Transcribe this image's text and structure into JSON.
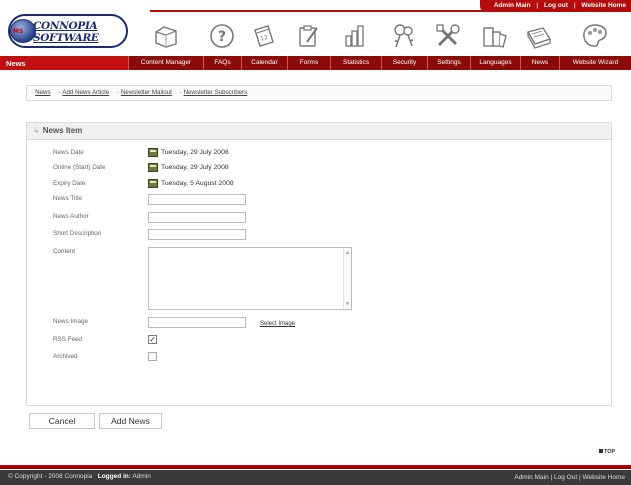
{
  "top_links": {
    "admin_main": "Admin Main",
    "log_out": "Log out",
    "website_home": "Website Home",
    "separator": "|"
  },
  "logo": {
    "word": "CONNOPIA SOFTWARE",
    "badge": "MS"
  },
  "nav": {
    "section_title": "News",
    "items": [
      {
        "label": "Content Manager",
        "icon": "folder-icon"
      },
      {
        "label": "FAQs",
        "icon": "question-icon"
      },
      {
        "label": "Calendar",
        "icon": "calendar-icon"
      },
      {
        "label": "Forms",
        "icon": "clipboard-icon"
      },
      {
        "label": "Statistics",
        "icon": "bar-chart-icon"
      },
      {
        "label": "Security",
        "icon": "keys-icon"
      },
      {
        "label": "Settings",
        "icon": "tools-icon"
      },
      {
        "label": "Languages",
        "icon": "books-icon"
      },
      {
        "label": "News",
        "icon": "newspaper-icon"
      },
      {
        "label": "Website Wizard",
        "icon": "palette-icon"
      }
    ]
  },
  "breadcrumb": {
    "items": [
      "News",
      "Add News Article",
      "Newsletter Mailout",
      "Newsletter Subscribers"
    ]
  },
  "panel": {
    "title": "News Item",
    "arrow": "↳"
  },
  "form": {
    "news_date_label": "News Date",
    "news_date_value": "Tuesday, 29 July 2008",
    "online_date_label": "Online (Start) Date",
    "online_date_value": "Tuesday, 29 July 2008",
    "expiry_date_label": "Expiry Date",
    "expiry_date_value": "Tuesday, 5 August 2008",
    "news_title_label": "News Title",
    "news_title_value": "",
    "news_author_label": "News Author",
    "news_author_value": "",
    "short_desc_label": "Short Description",
    "short_desc_value": "",
    "content_label": "Content",
    "content_value": "",
    "news_image_label": "News Image",
    "news_image_value": "",
    "select_image_label": "Select Image",
    "rss_feed_label": "RSS Feed",
    "rss_feed_checked": true,
    "archived_label": "Archived",
    "archived_checked": false
  },
  "buttons": {
    "cancel": "Cancel",
    "add_news": "Add News"
  },
  "top_anchor": "TOP",
  "footer": {
    "copyright": "© Copyright - 2008 Connopia",
    "logged_in_label": "Logged in:",
    "logged_in_user": "Admin",
    "admin_main": "Admin Main",
    "log_out": "Log Out",
    "website_home": "Website Home",
    "separator": "|"
  },
  "colors": {
    "brand_red": "#b40a0a",
    "dark_red": "#8b0a0a",
    "footer_bg": "#3a3a3a"
  }
}
